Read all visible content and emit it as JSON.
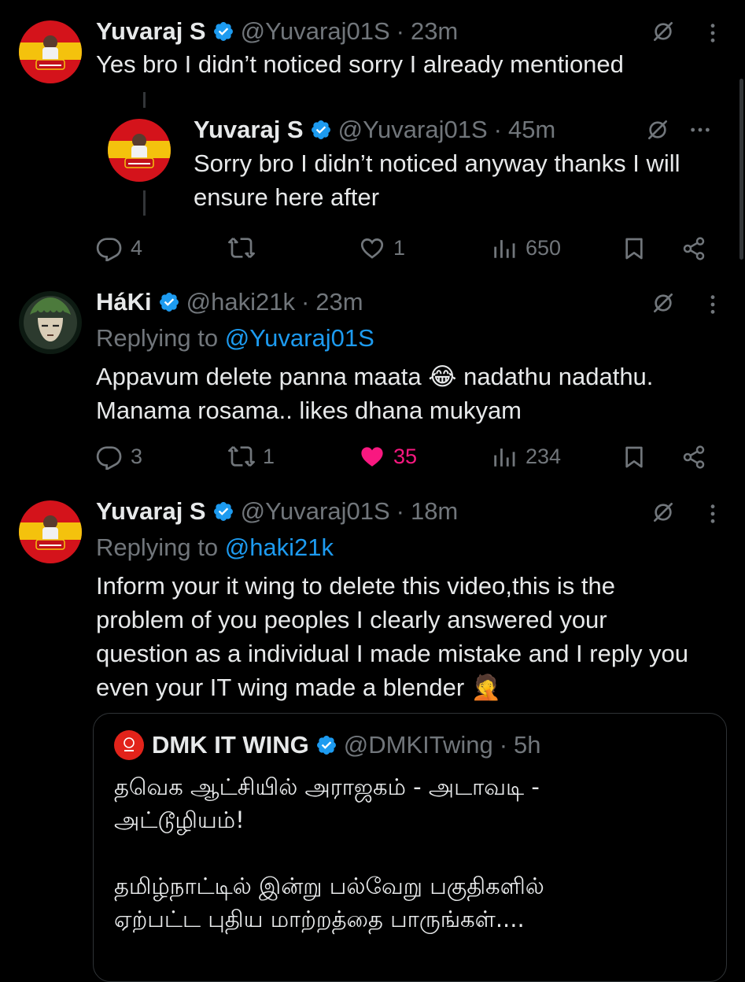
{
  "colors": {
    "background": "#000000",
    "text": "#e7e9ea",
    "muted": "#71767b",
    "link": "#1d9bf0",
    "like": "#f91880",
    "verified": "#1d9bf0"
  },
  "tweets": [
    {
      "name": "Yuvaraj S",
      "handle": "@Yuvaraj01S",
      "sep": "·",
      "time": "23m",
      "text": "Yes bro I didn’t noticed sorry I already mentioned",
      "avatar_icon": "flag-avatar-icon"
    },
    {
      "name": "Yuvaraj S",
      "handle": "@Yuvaraj01S",
      "sep": "·",
      "time": "45m",
      "text": "Sorry bro I didn’t noticed anyway thanks I will ensure here after",
      "avatar_icon": "flag-avatar-icon",
      "actions": {
        "replies": "4",
        "reposts": "",
        "likes": "1",
        "views": "650"
      }
    },
    {
      "name": "HáKi",
      "handle": "@haki21k",
      "sep": "·",
      "time": "23m",
      "replying_prefix": "Replying to",
      "replying_to": "@Yuvaraj01S",
      "text_line1": "Appavum delete panna maata 😂 nadathu nadathu.",
      "text_line2": "Manama rosama.. likes dhana mukyam",
      "avatar_icon": "anime-avatar-icon",
      "actions": {
        "replies": "3",
        "reposts": "1",
        "likes": "35",
        "views": "234"
      }
    },
    {
      "name": "Yuvaraj S",
      "handle": "@Yuvaraj01S",
      "sep": "·",
      "time": "18m",
      "replying_prefix": "Replying to",
      "replying_to": "@haki21k",
      "text": "Inform your it wing to delete this video,this is the problem of you peoples I clearly answered your question as a individual I made mistake and I reply you even your IT wing made a blender 🤦",
      "avatar_icon": "flag-avatar-icon"
    }
  ],
  "quote": {
    "name": "DMK IT WING",
    "handle": "@DMKITwing",
    "sep": "·",
    "time": "5h",
    "line1": "தவெக ஆட்சியில் அராஜகம் - அடாவடி -",
    "line2": "அட்டூழியம்!",
    "line3": "தமிழ்நாட்டில் இன்று பல்வேறு பகுதிகளில்",
    "line4": "ஏற்பட்ட புதிய மாற்றத்தை பாருங்கள்....",
    "logo_icon": "dmk-logo-icon"
  }
}
